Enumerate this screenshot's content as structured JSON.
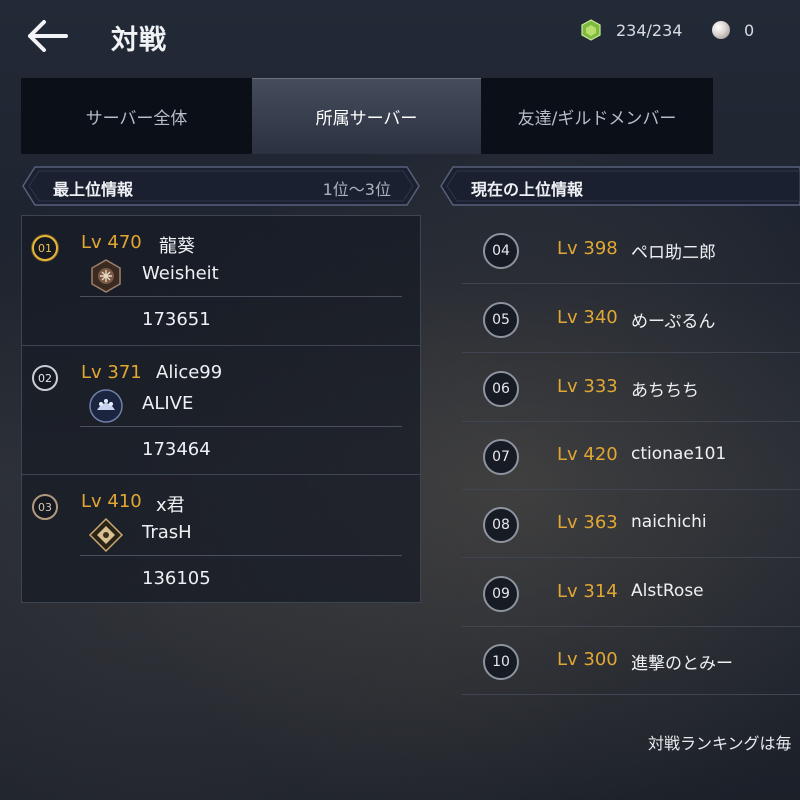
{
  "header": {
    "title": "対戦",
    "resources": [
      {
        "icon": "gem-icon",
        "value": "234/234"
      },
      {
        "icon": "pearl-icon",
        "value": "0"
      }
    ]
  },
  "tabs": [
    {
      "label": "サーバー全体",
      "active": false
    },
    {
      "label": "所属サーバー",
      "active": true
    },
    {
      "label": "友達/ギルドメンバー",
      "active": false
    }
  ],
  "top_section": {
    "title": "最上位情報",
    "range": "1位〜3位",
    "entries": [
      {
        "rank": "01",
        "level": "Lv 470",
        "name": "龍葵",
        "guild": "Weisheit",
        "score": "173651"
      },
      {
        "rank": "02",
        "level": "Lv 371",
        "name": "Alice99",
        "guild": "ALIVE",
        "score": "173464"
      },
      {
        "rank": "03",
        "level": "Lv 410",
        "name": "x君",
        "guild": "TrasH",
        "score": "136105"
      }
    ]
  },
  "current_section": {
    "title": "現在の上位情報",
    "entries": [
      {
        "rank": "04",
        "level": "Lv 398",
        "name": "ペロ助二郎"
      },
      {
        "rank": "05",
        "level": "Lv 340",
        "name": "めーぷるん"
      },
      {
        "rank": "06",
        "level": "Lv 333",
        "name": "あちちち"
      },
      {
        "rank": "07",
        "level": "Lv 420",
        "name": "ctionae101"
      },
      {
        "rank": "08",
        "level": "Lv 363",
        "name": "naichichi"
      },
      {
        "rank": "09",
        "level": "Lv 314",
        "name": "AlstRose"
      },
      {
        "rank": "10",
        "level": "Lv 300",
        "name": "進撃のとみー"
      }
    ]
  },
  "footer": {
    "text": "対戦ランキングは毎"
  },
  "colors": {
    "level": "#e2a733",
    "gold": "#e6b43a",
    "silver": "#c9ccd2",
    "bronze": "#b29a7e",
    "tab_active": "#3a4150"
  }
}
